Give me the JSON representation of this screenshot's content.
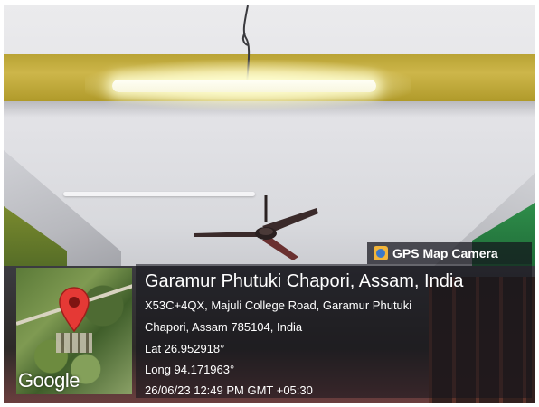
{
  "stamp": {
    "badge_label": "GPS Map Camera",
    "place_title": "Garamur Phutuki Chapori, Assam, India",
    "address_line1": "X53C+4QX, Majuli College Road, Garamur Phutuki",
    "address_line2": "Chapori, Assam 785104, India",
    "lat": "Lat 26.952918°",
    "long": "Long 94.171963°",
    "datetime": "26/06/23 12:49 PM GMT +05:30"
  },
  "map": {
    "logo_text": "Google",
    "pin_color": "#e53935"
  },
  "icons": {
    "badge_icon": "gps-map-camera-icon",
    "pin": "map-pin-icon"
  },
  "colors": {
    "beam": "#cdb64a",
    "overlay": "#14141c"
  }
}
